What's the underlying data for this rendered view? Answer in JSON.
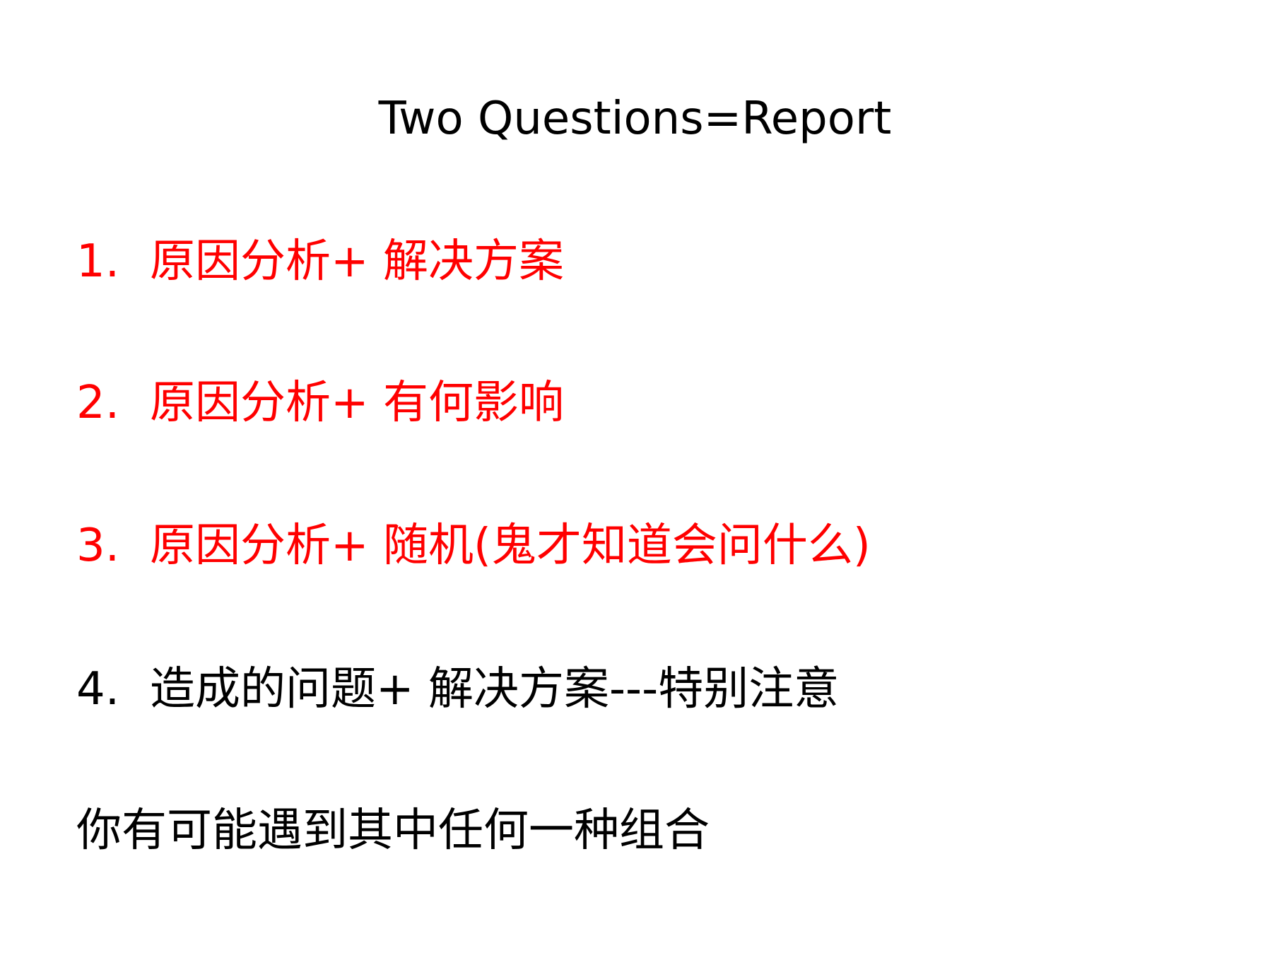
{
  "slide": {
    "title": "Two Questions=Report",
    "items": [
      {
        "number": "1.",
        "text": "原因分析+ 解决方案",
        "color": "#ff0000"
      },
      {
        "number": "2.",
        "text": "原因分析+ 有何影响",
        "color": "#ff0000"
      },
      {
        "number": "3.",
        "text": "原因分析+ 随机(鬼才知道会问什么)",
        "color": "#ff0000"
      },
      {
        "number": "4.",
        "text": "造成的问题+ 解决方案---特别注意",
        "color": "#000000"
      }
    ],
    "note": "你有可能遇到其中任何一种组合"
  }
}
